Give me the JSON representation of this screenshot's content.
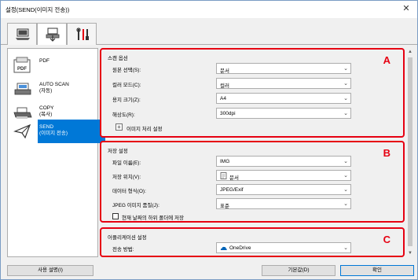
{
  "window": {
    "title": "설정(SEND(이미지 전송))",
    "close_glyph": "✕"
  },
  "tabs": [
    {
      "icon": "computer-icon",
      "active": false
    },
    {
      "icon": "scan-to-folder-icon",
      "active": true
    },
    {
      "icon": "tools-icon",
      "active": false
    }
  ],
  "sidebar": {
    "items": [
      {
        "label_line1": "PDF",
        "label_line2": "",
        "icon": "pdf-icon",
        "selected": false
      },
      {
        "label_line1": "AUTO SCAN",
        "label_line2": "(자동)",
        "icon": "auto-scan-icon",
        "selected": false
      },
      {
        "label_line1": "COPY",
        "label_line2": "(복사)",
        "icon": "copy-icon",
        "selected": false
      },
      {
        "label_line1": "SEND",
        "label_line2": "(이미지 전송)",
        "icon": "send-icon",
        "selected": true
      }
    ]
  },
  "scan_options": {
    "title": "스캔 옵션",
    "letter": "A",
    "rows": [
      {
        "label": "원본 선택(S):",
        "value": "문서"
      },
      {
        "label": "컬러 모드(C):",
        "value": "컬러"
      },
      {
        "label": "용지 크기(Z):",
        "value": "A4"
      },
      {
        "label": "해상도(R):",
        "value": "300dpi"
      }
    ],
    "expander_glyph": "+",
    "expander_label": "이미지 처리 설정"
  },
  "save_settings": {
    "title": "저장 설정",
    "letter": "B",
    "rows": [
      {
        "label": "파일 이름(E):",
        "value": "IMG",
        "icon": ""
      },
      {
        "label": "저장 위치(V):",
        "value": "문서",
        "icon": "document-folder-icon"
      },
      {
        "label": "데이터 형식(O):",
        "value": "JPEG/Exif",
        "icon": ""
      },
      {
        "label": "JPEG 이미지 품질(J):",
        "value": "표준",
        "icon": ""
      }
    ],
    "checkbox_label": "현재 날짜의 하위 폴더에 저장",
    "checkbox_checked": false
  },
  "app_settings": {
    "title": "어플리케이션 설정",
    "letter": "C",
    "row": {
      "label": "전송 방법:",
      "value": "OneDrive",
      "icon": "onedrive-icon"
    }
  },
  "footer": {
    "instructions_label": "사용 설명(I)",
    "defaults_label": "기본값(D)",
    "ok_label": "확인"
  },
  "colors": {
    "highlight_red": "#e60012",
    "selection_blue": "#0078d7"
  }
}
